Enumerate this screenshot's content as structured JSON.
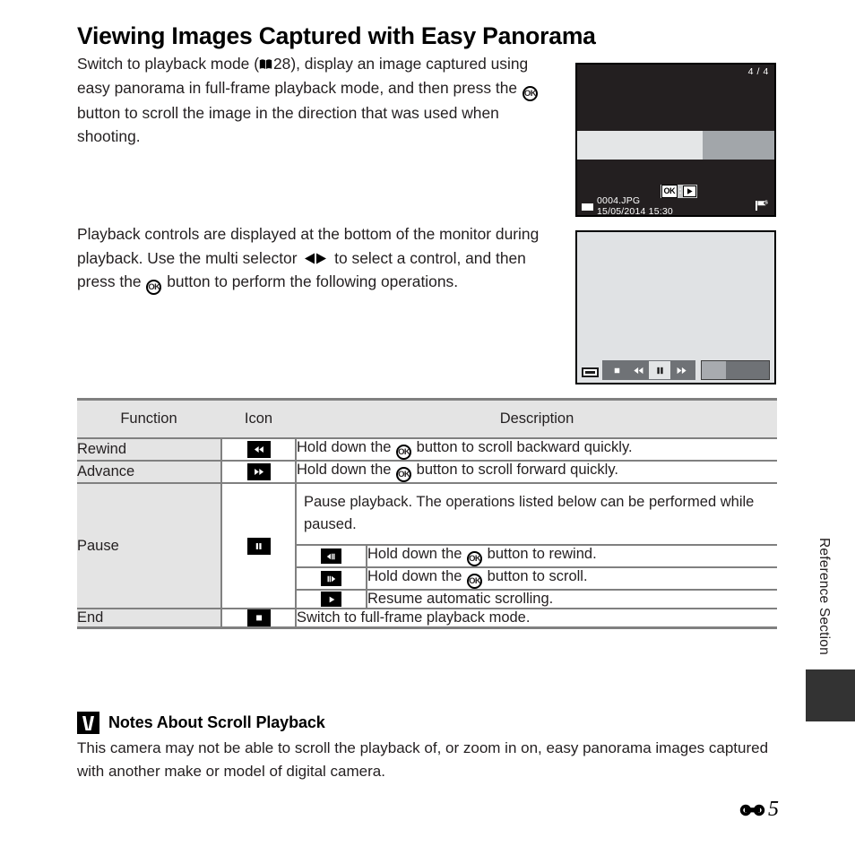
{
  "page": {
    "title": "Viewing Images Captured with Easy Panorama",
    "paragraph_1_parts": {
      "a": "Switch to playback mode (",
      "page_ref": "28), display an image captured using easy panorama in full-frame playback mode, and then press the ",
      "b": " button to scroll the image in the direction that was used when shooting."
    },
    "paragraph_2_parts": {
      "a": "Playback controls are displayed at the bottom of the monitor during playback. Use the multi selector ",
      "b": " to select a control, and then press the ",
      "c": " button to perform the following operations."
    },
    "ok_glyph": "OK",
    "footer_number": "5",
    "side_label": "Reference Section"
  },
  "monitor_1": {
    "frame_counter": "4 / 4",
    "ok_badge_label": "OK",
    "ok_badge_colon": ":",
    "file_name": "0004.JPG",
    "file_date": "15/05/2014  15:30"
  },
  "monitor_2": {
    "controls": [
      {
        "name": "stop",
        "selected": false
      },
      {
        "name": "rewind",
        "selected": false
      },
      {
        "name": "pause",
        "selected": true
      },
      {
        "name": "advance",
        "selected": false
      }
    ]
  },
  "table": {
    "headers": {
      "function": "Function",
      "icon": "Icon",
      "description": "Description"
    },
    "rows": [
      {
        "function": "Rewind",
        "icon": "rewind-icon",
        "description_a": "Hold down the ",
        "description_b": " button to scroll backward quickly."
      },
      {
        "function": "Advance",
        "icon": "advance-icon",
        "description_a": "Hold down the ",
        "description_b": " button to scroll forward quickly."
      },
      {
        "function": "Pause",
        "icon": "pause-icon",
        "description_main": "Pause playback. The operations listed below can be performed while paused.",
        "sub_rows": [
          {
            "icon": "frame-rewind-icon",
            "description_a": "Hold down the ",
            "description_b": " button to rewind."
          },
          {
            "icon": "frame-advance-icon",
            "description_a": "Hold down the ",
            "description_b": " button to scroll."
          },
          {
            "icon": "play-icon",
            "description_full": "Resume automatic scrolling."
          }
        ]
      },
      {
        "function": "End",
        "icon": "stop-icon",
        "description_full": "Switch to full-frame playback mode."
      }
    ]
  },
  "notes": {
    "title": "Notes About Scroll Playback",
    "body": "This camera may not be able to scroll the playback of, or zoom in on, easy panorama images captured with another make or model of digital camera."
  },
  "colors": {
    "text": "#231f20",
    "table_header_bg": "#e4e4e4",
    "table_border": "#808080",
    "monitor_dark": "#231f20",
    "monitor_light": "#e0e2e4",
    "control_bar": "#6f7276",
    "side_tab": "#333333"
  }
}
